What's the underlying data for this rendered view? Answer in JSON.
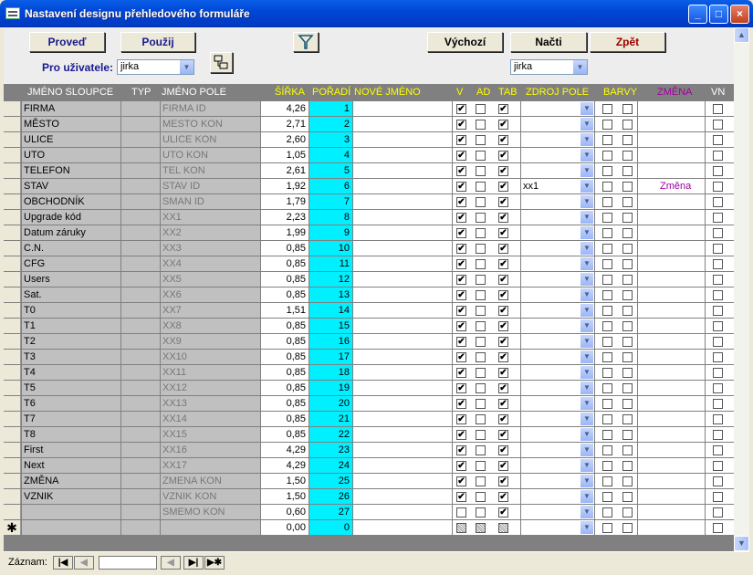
{
  "window": {
    "title": "Nastavení designu přehledového formuláře",
    "minimize": "_",
    "maximize": "□",
    "close": "×"
  },
  "header": {
    "execute_label": "Proveď",
    "apply_label": "Použij",
    "default_label": "Výchozí",
    "load_label": "Načti",
    "back_label": "Zpět",
    "user_label": "Pro uživatele:",
    "user_value": "jirka",
    "right_user_value": "jirka"
  },
  "columns": {
    "col_name": "JMÉNO SLOUPCE",
    "type": "TYP",
    "field_name": "JMÉNO POLE",
    "width": "ŠÍŘKA",
    "order": "POŘADÍ",
    "new_name": "NOVÉ JMÉNO",
    "v": "V",
    "ad": "AD",
    "tab": "TAB",
    "source": "ZDROJ POLE",
    "colors": "BARVY",
    "change": "ZMĚNA",
    "vn": "VN"
  },
  "rows": [
    {
      "col": "FIRMA",
      "field": "FIRMA ID",
      "width": "4,26",
      "order": "1",
      "v": true,
      "ad": false,
      "tab": true,
      "source": "",
      "change": ""
    },
    {
      "col": "MĚSTO",
      "field": "MESTO KON",
      "width": "2,71",
      "order": "2",
      "v": true,
      "ad": false,
      "tab": true,
      "source": "",
      "change": ""
    },
    {
      "col": "ULICE",
      "field": "ULICE KON",
      "width": "2,60",
      "order": "3",
      "v": true,
      "ad": false,
      "tab": true,
      "source": "",
      "change": ""
    },
    {
      "col": "UTO",
      "field": "UTO KON",
      "width": "1,05",
      "order": "4",
      "v": true,
      "ad": false,
      "tab": true,
      "source": "",
      "change": ""
    },
    {
      "col": "TELEFON",
      "field": "TEL KON",
      "width": "2,61",
      "order": "5",
      "v": true,
      "ad": false,
      "tab": true,
      "source": "",
      "change": ""
    },
    {
      "col": "STAV",
      "field": "STAV ID",
      "width": "1,92",
      "order": "6",
      "v": true,
      "ad": false,
      "tab": true,
      "source": "xx1",
      "change": "Změna"
    },
    {
      "col": "OBCHODNÍK",
      "field": "SMAN ID",
      "width": "1,79",
      "order": "7",
      "v": true,
      "ad": false,
      "tab": true,
      "source": "",
      "change": ""
    },
    {
      "col": "Upgrade kód",
      "field": "XX1",
      "width": "2,23",
      "order": "8",
      "v": true,
      "ad": false,
      "tab": true,
      "source": "",
      "change": ""
    },
    {
      "col": "Datum záruky",
      "field": "XX2",
      "width": "1,99",
      "order": "9",
      "v": true,
      "ad": false,
      "tab": true,
      "source": "",
      "change": ""
    },
    {
      "col": "C.N.",
      "field": "XX3",
      "width": "0,85",
      "order": "10",
      "v": true,
      "ad": false,
      "tab": true,
      "source": "",
      "change": ""
    },
    {
      "col": "CFG",
      "field": "XX4",
      "width": "0,85",
      "order": "11",
      "v": true,
      "ad": false,
      "tab": true,
      "source": "",
      "change": ""
    },
    {
      "col": "Users",
      "field": "XX5",
      "width": "0,85",
      "order": "12",
      "v": true,
      "ad": false,
      "tab": true,
      "source": "",
      "change": ""
    },
    {
      "col": "Sat.",
      "field": "XX6",
      "width": "0,85",
      "order": "13",
      "v": true,
      "ad": false,
      "tab": true,
      "source": "",
      "change": ""
    },
    {
      "col": "T0",
      "field": "XX7",
      "width": "1,51",
      "order": "14",
      "v": true,
      "ad": false,
      "tab": true,
      "source": "",
      "change": ""
    },
    {
      "col": "T1",
      "field": "XX8",
      "width": "0,85",
      "order": "15",
      "v": true,
      "ad": false,
      "tab": true,
      "source": "",
      "change": ""
    },
    {
      "col": "T2",
      "field": "XX9",
      "width": "0,85",
      "order": "16",
      "v": true,
      "ad": false,
      "tab": true,
      "source": "",
      "change": ""
    },
    {
      "col": "T3",
      "field": "XX10",
      "width": "0,85",
      "order": "17",
      "v": true,
      "ad": false,
      "tab": true,
      "source": "",
      "change": ""
    },
    {
      "col": "T4",
      "field": "XX11",
      "width": "0,85",
      "order": "18",
      "v": true,
      "ad": false,
      "tab": true,
      "source": "",
      "change": ""
    },
    {
      "col": "T5",
      "field": "XX12",
      "width": "0,85",
      "order": "19",
      "v": true,
      "ad": false,
      "tab": true,
      "source": "",
      "change": ""
    },
    {
      "col": "T6",
      "field": "XX13",
      "width": "0,85",
      "order": "20",
      "v": true,
      "ad": false,
      "tab": true,
      "source": "",
      "change": ""
    },
    {
      "col": "T7",
      "field": "XX14",
      "width": "0,85",
      "order": "21",
      "v": true,
      "ad": false,
      "tab": true,
      "source": "",
      "change": ""
    },
    {
      "col": "T8",
      "field": "XX15",
      "width": "0,85",
      "order": "22",
      "v": true,
      "ad": false,
      "tab": true,
      "source": "",
      "change": ""
    },
    {
      "col": "First",
      "field": "XX16",
      "width": "4,29",
      "order": "23",
      "v": true,
      "ad": false,
      "tab": true,
      "source": "",
      "change": ""
    },
    {
      "col": "Next",
      "field": "XX17",
      "width": "4,29",
      "order": "24",
      "v": true,
      "ad": false,
      "tab": true,
      "source": "",
      "change": ""
    },
    {
      "col": "ZMĚNA",
      "field": "ZMENA KON",
      "width": "1,50",
      "order": "25",
      "v": true,
      "ad": false,
      "tab": true,
      "source": "",
      "change": ""
    },
    {
      "col": "VZNIK",
      "field": "VZNIK KON",
      "width": "1,50",
      "order": "26",
      "v": true,
      "ad": false,
      "tab": true,
      "source": "",
      "change": ""
    },
    {
      "col": "",
      "field": "SMEMO KON",
      "width": "0,60",
      "order": "27",
      "v": false,
      "ad": false,
      "tab": true,
      "source": "",
      "change": ""
    }
  ],
  "new_row": {
    "marker": "✱",
    "width": "0,00",
    "order": "0"
  },
  "footer": {
    "record_label": "Záznam:",
    "first": "|◀",
    "prev": "◀",
    "next": "▶|",
    "last": "▶✱"
  },
  "colors": {
    "title_bar": "#0047d6",
    "header_yellow": "#ffff00",
    "order_cyan": "#00f0ff",
    "change_purple": "#a000a0"
  }
}
